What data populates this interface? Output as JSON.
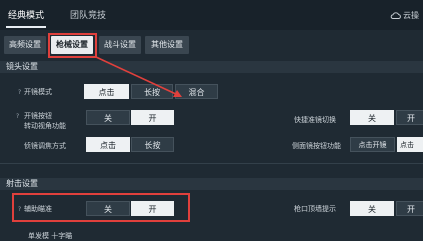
{
  "top_tabs": [
    {
      "label": "经典模式",
      "active": true
    },
    {
      "label": "团队竞技",
      "active": false
    }
  ],
  "cloud_label": "云操",
  "sub_tabs": [
    {
      "label": "高频设置",
      "active": false
    },
    {
      "label": "枪械设置",
      "active": true
    },
    {
      "label": "战斗设置",
      "active": false
    },
    {
      "label": "其他设置",
      "active": false
    }
  ],
  "sections": {
    "lens": "镜头设置",
    "shoot": "射击设置"
  },
  "rows": {
    "scope_mode": {
      "label": "开镜模式",
      "options": [
        "点击",
        "长按",
        "混合"
      ],
      "selected": 0
    },
    "scope_button": {
      "label_line1": "开镜按钮",
      "label_line2": "转动视角功能",
      "options": [
        "关",
        "开"
      ],
      "selected": 1
    },
    "quick_switch": {
      "label": "快捷准镜切换",
      "options": [
        "关",
        "开"
      ],
      "selected": 0
    },
    "tilt_focus": {
      "label": "侦镜调焦方式",
      "options": [
        "点击",
        "长按"
      ],
      "selected": 0
    },
    "side_scope": {
      "label": "侧面镜按钮功能",
      "options": [
        "点击开镜",
        "点击"
      ],
      "selected": 1
    },
    "aim_assist": {
      "label": "辅助瞄准",
      "options": [
        "关",
        "开"
      ],
      "selected": 1
    },
    "muzzle_hint": {
      "label": "枪口顶墙提示",
      "options": [
        "关",
        "开"
      ],
      "selected": 0
    },
    "partial_row": {
      "label": "单发模 十字瞄"
    }
  },
  "colors": {
    "highlight": "#e0403c",
    "selected_bg": "#eef1f3",
    "unselected_bg": "#2f3c46"
  }
}
